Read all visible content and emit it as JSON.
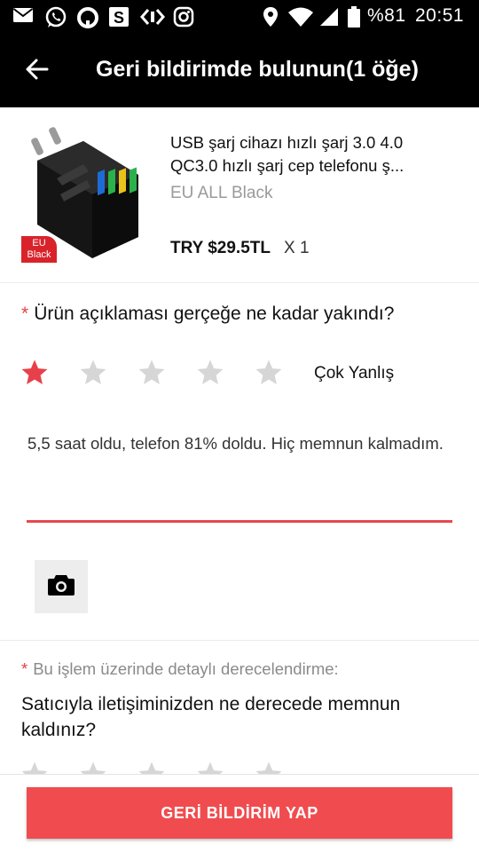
{
  "status_bar": {
    "icons": [
      "mail-icon",
      "whatsapp-icon",
      "circle-app-icon",
      "s-app-icon",
      "code-app-icon",
      "instagram-icon",
      "location-icon",
      "wifi-icon",
      "signal-icon",
      "battery-icon"
    ],
    "battery": "%81",
    "time": "20:51"
  },
  "header": {
    "title": "Geri bildirimde bulunun(1 öğe)",
    "back_icon": "arrow-left-icon"
  },
  "product": {
    "title_line1": "USB şarj cihazı hızlı şarj 3.0 4.0",
    "title_line2": "QC3.0 hızlı şarj cep telefonu ş...",
    "variant": "EU ALL Black",
    "price": "TRY $29.5TL",
    "quantity": "X 1",
    "badge_line1": "EU",
    "badge_line2": "Black"
  },
  "question1": {
    "required_mark": "*",
    "text": "Ürün açıklaması gerçeğe ne kadar yakındı?",
    "rating": 1,
    "max": 5,
    "rating_label": "Çok Yanlış"
  },
  "comment": {
    "text": "5,5 saat oldu, telefon 81% doldu. Hiç memnun kalmadım."
  },
  "camera": {
    "icon": "camera-icon"
  },
  "seller_rating": {
    "required_mark": "*",
    "subheading": "Bu işlem üzerinde detaylı derecelendirme:",
    "question": "Satıcıyla iletişiminizden ne derecede memnun kaldınız?"
  },
  "submit": {
    "label": "GERİ BİLDİRİM YAP"
  },
  "colors": {
    "accent": "#f04c4f",
    "star_active": "#e8404a",
    "star_inactive": "#d6d6d6",
    "header_bg": "#000000"
  }
}
